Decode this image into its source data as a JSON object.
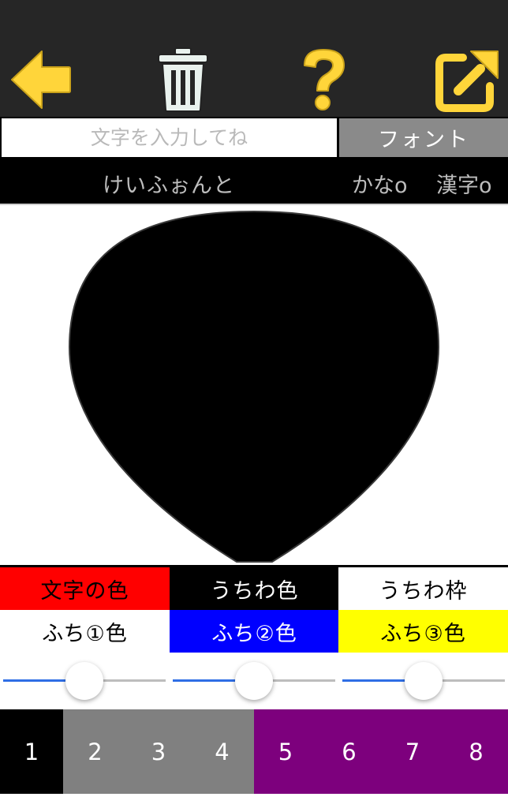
{
  "toolbar": {
    "background": "#262626",
    "accent": "#ffd53a",
    "buttons": [
      {
        "name": "back-arrow-icon"
      },
      {
        "name": "trash-icon"
      },
      {
        "name": "question-mark-icon"
      },
      {
        "name": "share-icon"
      }
    ]
  },
  "input": {
    "placeholder": "文字を入力してね",
    "value": ""
  },
  "font_button": {
    "label": "フォント"
  },
  "font_row": {
    "font_name": "けいふぉんと",
    "kana_option": "かなo",
    "kanji_option": "漢字o"
  },
  "canvas": {
    "uchiwa_color": "#000000"
  },
  "color_buttons": [
    {
      "label": "文字の色",
      "bg": "#ff0000",
      "fg": "#000000"
    },
    {
      "label": "うちわ色",
      "bg": "#000000",
      "fg": "#ffffff"
    },
    {
      "label": "うちわ枠",
      "bg": "#ffffff",
      "fg": "#000000"
    },
    {
      "label": "ふち①色",
      "bg": "#ffffff",
      "fg": "#000000"
    },
    {
      "label": "ふち②色",
      "bg": "#0000ff",
      "fg": "#ffffff"
    },
    {
      "label": "ふち③色",
      "bg": "#ffff00",
      "fg": "#000000"
    }
  ],
  "sliders": [
    {
      "value": 0.5
    },
    {
      "value": 0.5
    },
    {
      "value": 0.5
    }
  ],
  "number_tabs": [
    {
      "label": "1",
      "bg": "#000000"
    },
    {
      "label": "2",
      "bg": "#808080"
    },
    {
      "label": "3",
      "bg": "#808080"
    },
    {
      "label": "4",
      "bg": "#808080"
    },
    {
      "label": "5",
      "bg": "#7d007d"
    },
    {
      "label": "6",
      "bg": "#7d007d"
    },
    {
      "label": "7",
      "bg": "#7d007d"
    },
    {
      "label": "8",
      "bg": "#7d007d"
    }
  ]
}
